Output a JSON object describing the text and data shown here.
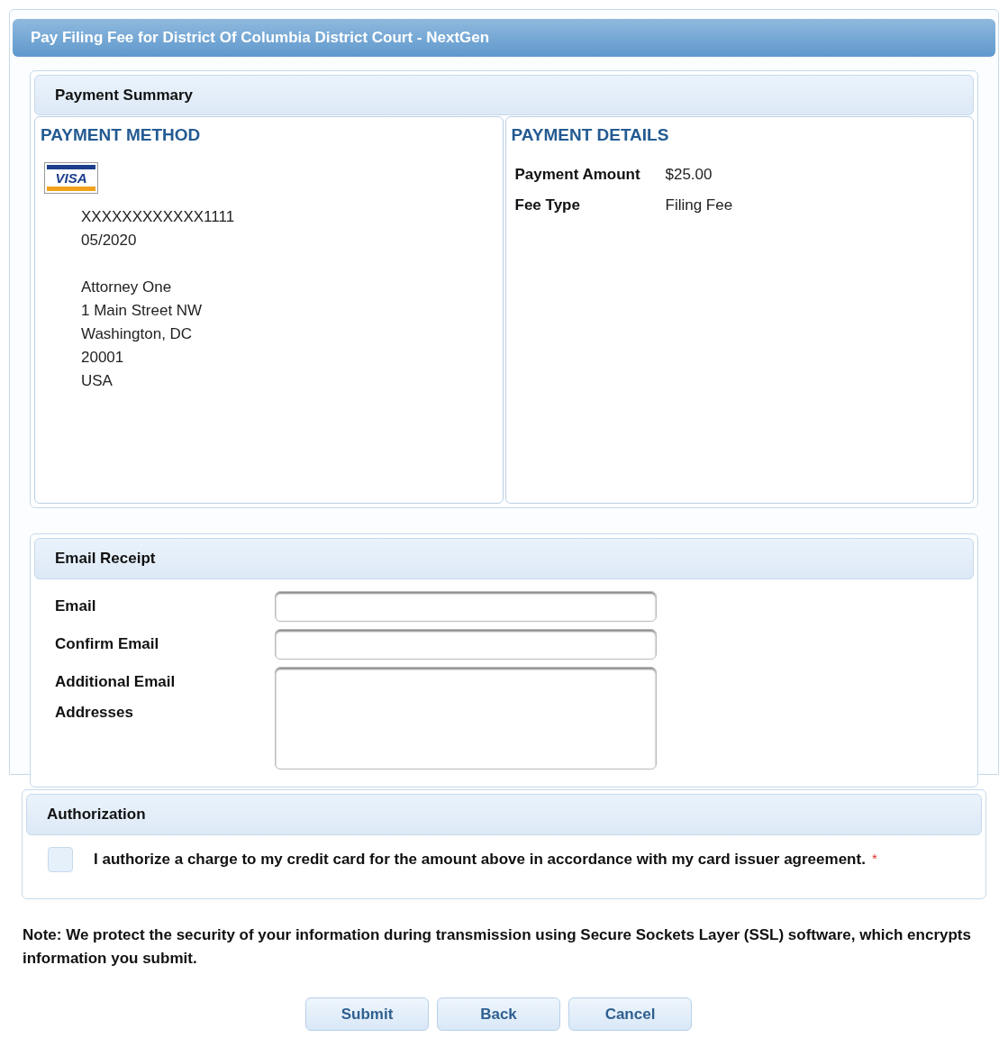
{
  "window": {
    "title": "Pay Filing Fee for District Of Columbia District Court - NextGen"
  },
  "payment_summary": {
    "title": "Payment Summary",
    "payment_method": {
      "heading": "PAYMENT METHOD",
      "card_logo": "VISA",
      "lines": [
        "XXXXXXXXXXXX1111",
        "05/2020"
      ],
      "address": [
        "Attorney One",
        "1 Main Street NW",
        "Washington, DC",
        "20001",
        "USA"
      ]
    },
    "payment_details": {
      "heading": "PAYMENT DETAILS",
      "rows": [
        {
          "label": "Payment Amount",
          "value": "$25.00"
        },
        {
          "label": "Fee Type",
          "value": "Filing Fee"
        }
      ]
    }
  },
  "email_receipt": {
    "title": "Email Receipt",
    "fields": [
      {
        "label": "Email",
        "kind": "input"
      },
      {
        "label": "Confirm Email",
        "kind": "input"
      },
      {
        "label": "Additional Email Addresses",
        "kind": "textarea"
      }
    ]
  },
  "authorization": {
    "title": "Authorization",
    "checked": false,
    "text": "I authorize a charge to my credit card for the amount above in accordance with my card issuer agreement.",
    "required_mark": "*"
  },
  "note": "Note: We protect the security of your information during transmission using Secure Sockets Layer (SSL) software, which encrypts information you submit.",
  "buttons": [
    "Submit",
    "Back",
    "Cancel"
  ]
}
